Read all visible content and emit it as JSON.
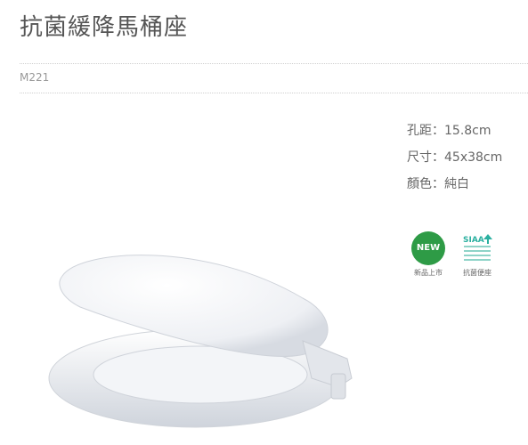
{
  "product": {
    "title": "抗菌緩降馬桶座",
    "model": "M221"
  },
  "specs": [
    "孔距：15.8cm",
    "尺寸：45x38cm",
    "顏色：純白"
  ],
  "badges": {
    "new_label": "NEW",
    "new_caption": "新品上市",
    "siaa_label": "SIAA",
    "siaa_caption": "抗菌便座"
  },
  "colors": {
    "new_badge": "#2e9b46",
    "siaa_badge": "#2bb0a0"
  }
}
